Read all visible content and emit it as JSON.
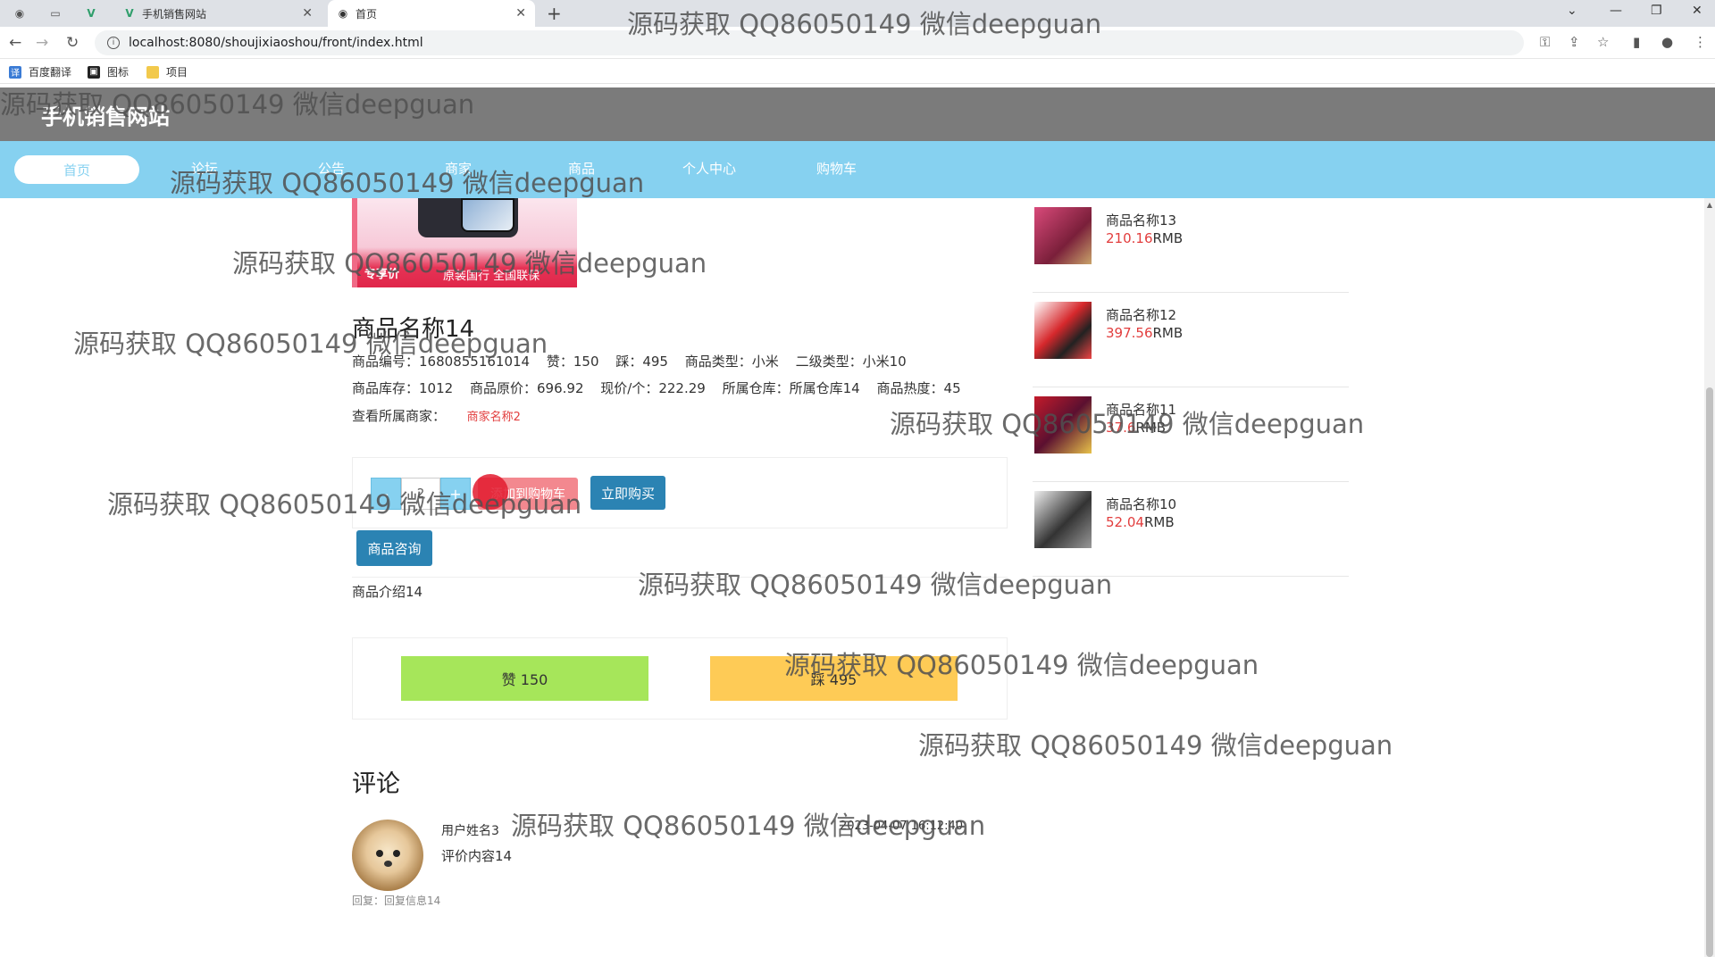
{
  "browser": {
    "tabs": [
      {
        "label": "手机销售网站",
        "active": false
      },
      {
        "label": "首页",
        "active": true
      }
    ],
    "url": "localhost:8080/shoujixiaoshou/front/index.html",
    "bookmarks": [
      "百度翻译",
      "图标",
      "项目"
    ],
    "close_glyph": "✕",
    "new_tab_glyph": "+"
  },
  "site": {
    "title": "手机销售网站",
    "nav": [
      "首页",
      "论坛",
      "公告",
      "商家",
      "商品",
      "个人中心",
      "购物车"
    ]
  },
  "product": {
    "image_promo_tag": "专享价",
    "image_promo_text": "原装国行 全国联保",
    "name": "商品名称14",
    "code_label": "商品编号：",
    "code": "1680855161014",
    "likes_label": "赞：",
    "likes": "150",
    "dislikes_label": "踩：",
    "dislikes": "495",
    "type_label": "商品类型：",
    "type": "小米",
    "subtype_label": "二级类型：",
    "subtype": "小米10",
    "stock_label": "商品库存：",
    "stock": "1012",
    "original_price_label": "商品原价：",
    "original_price": "696.92",
    "current_price_label": "现价/个：",
    "current_price": "222.29",
    "warehouse_label": "所属仓库：",
    "warehouse": "所属仓库14",
    "heat_label": "商品热度：",
    "heat": "45",
    "merchant_label": "查看所属商家：",
    "merchant": "商家名称2",
    "quantity": "2",
    "minus_label": "-",
    "plus_label": "+",
    "add_cart_label": "添加到购物车",
    "buy_now_label": "立即购买",
    "consult_label": "商品咨询",
    "intro": "商品介绍14",
    "like_button": "赞   150",
    "dislike_button": "踩   495"
  },
  "comments": {
    "title": "评论",
    "items": [
      {
        "user": "用户姓名3",
        "time": "2023-04-07 16:12:40",
        "content": "评价内容14",
        "reply": "回复：回复信息14"
      }
    ]
  },
  "recommend": [
    {
      "name": "商品名称13",
      "price": "210.16",
      "unit": "RMB"
    },
    {
      "name": "商品名称12",
      "price": "397.56",
      "unit": "RMB"
    },
    {
      "name": "商品名称11",
      "price": "37.6",
      "unit": "RMB"
    },
    {
      "name": "商品名称10",
      "price": "52.04",
      "unit": "RMB"
    }
  ],
  "watermark": "源码获取 QQ86050149 微信deepguan",
  "colors": {
    "nav_bg": "#86d1f0",
    "header_bg": "#7b7b7b",
    "primary_button": "#2b83b3",
    "like": "#a6e65a",
    "dislike": "#fecb56",
    "price": "#e23d3d"
  }
}
